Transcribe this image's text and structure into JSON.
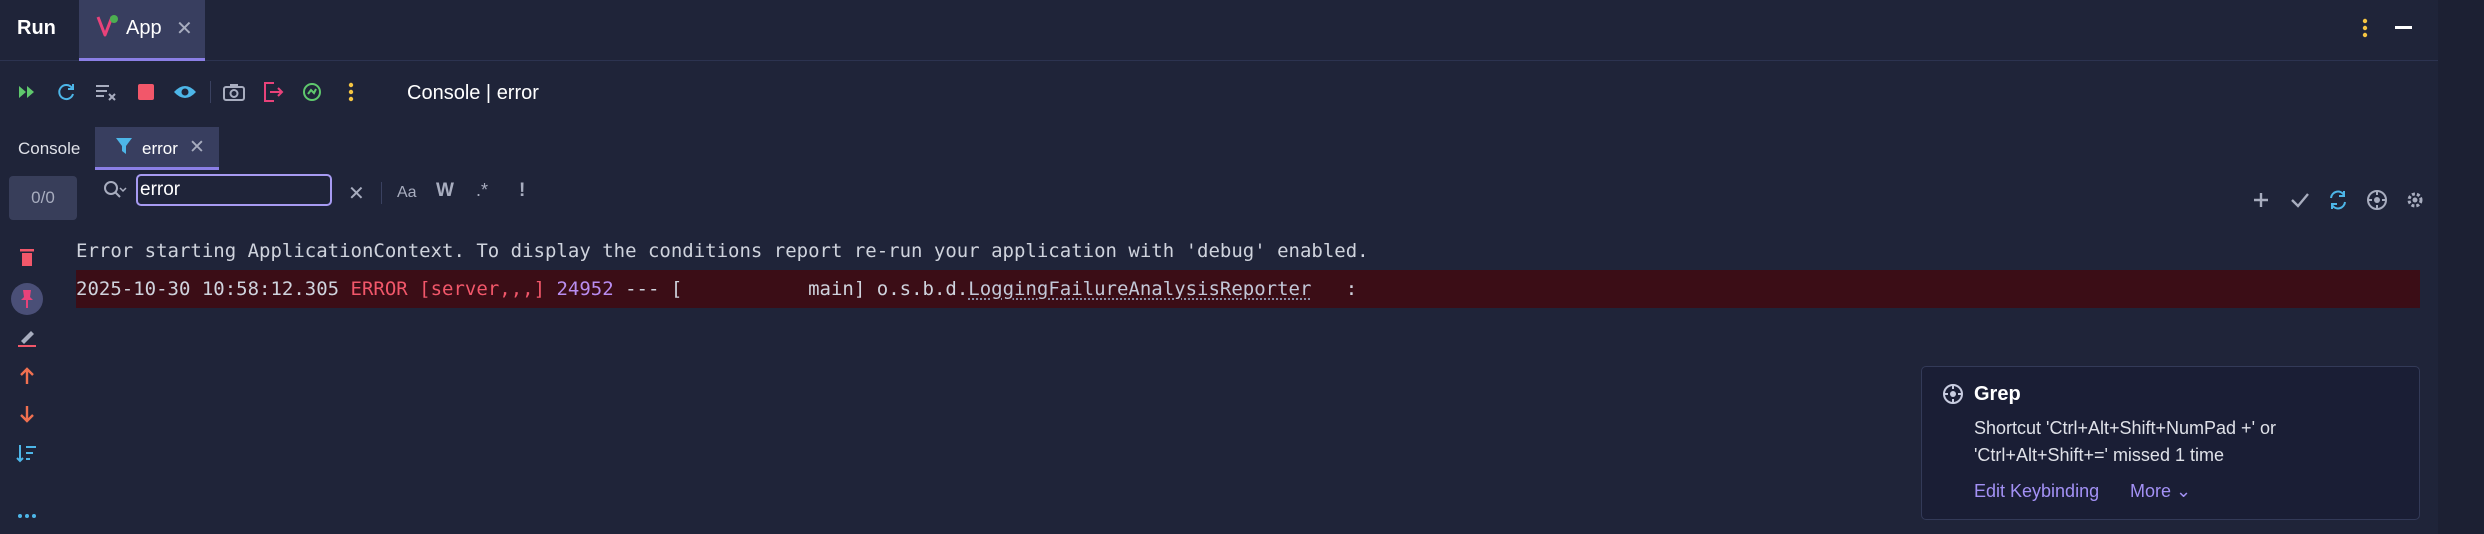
{
  "header": {
    "title": "Run",
    "tab_label": "App",
    "close_glyph": "✕"
  },
  "toolbar": {
    "icons": [
      "rerun-icon",
      "restart-icon",
      "clear-all-icon",
      "stop-icon",
      "watch-icon",
      "screenshot-icon",
      "exit-icon",
      "profiler-icon",
      "more-icon"
    ],
    "title": "Console | error"
  },
  "subtabs": {
    "console_label": "Console",
    "error_label": "error",
    "close_glyph": "✕"
  },
  "search": {
    "counter": "0/0",
    "value": "error",
    "clear_glyph": "✕",
    "opt_case": "Aa",
    "opt_word": "W",
    "opt_regex": ".*",
    "opt_exclude": "!"
  },
  "console": {
    "line1": "Error starting ApplicationContext. To display the conditions report re-run your application with 'debug' enabled.",
    "line2": {
      "timestamp": "2025-10-30 10:58:12.305 ",
      "level": "ERROR [server,,,] ",
      "pid": "24952",
      "sep": " --- [           main] o.s.b.d.",
      "class": "LoggingFailureAnalysisReporter",
      "tail": "   :"
    }
  },
  "popup": {
    "title": "Grep",
    "body": "Shortcut 'Ctrl+Alt+Shift+NumPad +' or 'Ctrl+Alt+Shift+=' missed 1 time",
    "link_edit": "Edit Keybinding",
    "link_more": "More ⌄"
  },
  "colors": {
    "background": "#1f2439",
    "accent": "#8b7fe6",
    "error_text": "#f2576a",
    "error_row": "#3b0d16",
    "link": "#a391f5"
  }
}
